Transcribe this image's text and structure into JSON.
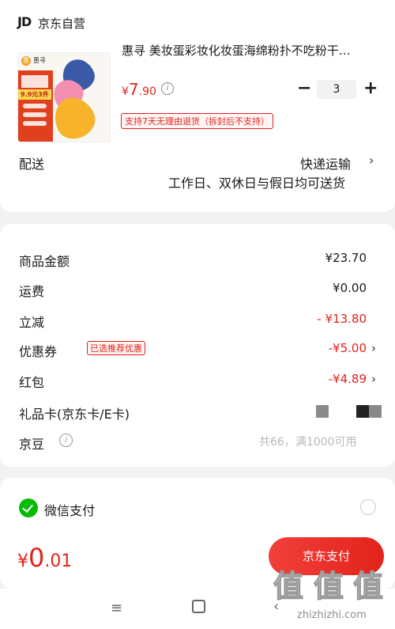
{
  "store": {
    "logo": "JD",
    "name": "京东自营"
  },
  "product": {
    "thumbnail": {
      "brand_mark": "惠",
      "brand_name": "惠寻",
      "promo": "9.9元3件",
      "egg_colors": [
        "#3a5aa8",
        "#f48fb1",
        "#f7b32b"
      ]
    },
    "title": "惠寻  美妆蛋彩妆化妆蛋海绵粉扑不吃粉干…",
    "price_currency": "¥",
    "price_int": "7",
    "price_dec": ".90",
    "info_icon": "i",
    "quantity": "3",
    "minus_label": "−",
    "plus_label": "+",
    "return_policy": "支持7天无理由退货（拆封后不支持）"
  },
  "delivery": {
    "label": "配送",
    "method": "快递运输",
    "note": "工作日、双休日与假日均可送货",
    "chevron": "›"
  },
  "fees": [
    {
      "label": "商品金额",
      "value": "¥23.70",
      "color": "#1a1a1a"
    },
    {
      "label": "运费",
      "value": "¥0.00",
      "color": "#1a1a1a"
    },
    {
      "label": "立减",
      "value": "- ¥13.80",
      "color": "#e2231a"
    },
    {
      "label": "优惠券",
      "tag": "已选推荐优惠",
      "value": "-¥5.00",
      "chevron": "›",
      "color": "#e2231a"
    },
    {
      "label": "红包",
      "value": "-¥4.89",
      "chevron": "›",
      "color": "#e2231a"
    },
    {
      "label": "礼品卡(京东卡/E卡)"
    },
    {
      "label": "京豆",
      "info_icon": "i",
      "note": "共66，满1000可用"
    }
  ],
  "payment": {
    "method": "微信支付",
    "icon": "wechat-icon"
  },
  "checkout": {
    "currency": "¥",
    "total_int": "0",
    "total_dec": ".01",
    "pay_button": "京东支付"
  },
  "navbar": {
    "menu_glyph": "≡",
    "back_glyph": "‹"
  },
  "watermark": {
    "glyphs": [
      "值",
      "值",
      "值"
    ],
    "url": "zhizhizhi.com"
  },
  "colors": {
    "accent_red": "#e2231a",
    "wechat_green": "#09bb07",
    "page_bg": "#f2f2f2"
  }
}
